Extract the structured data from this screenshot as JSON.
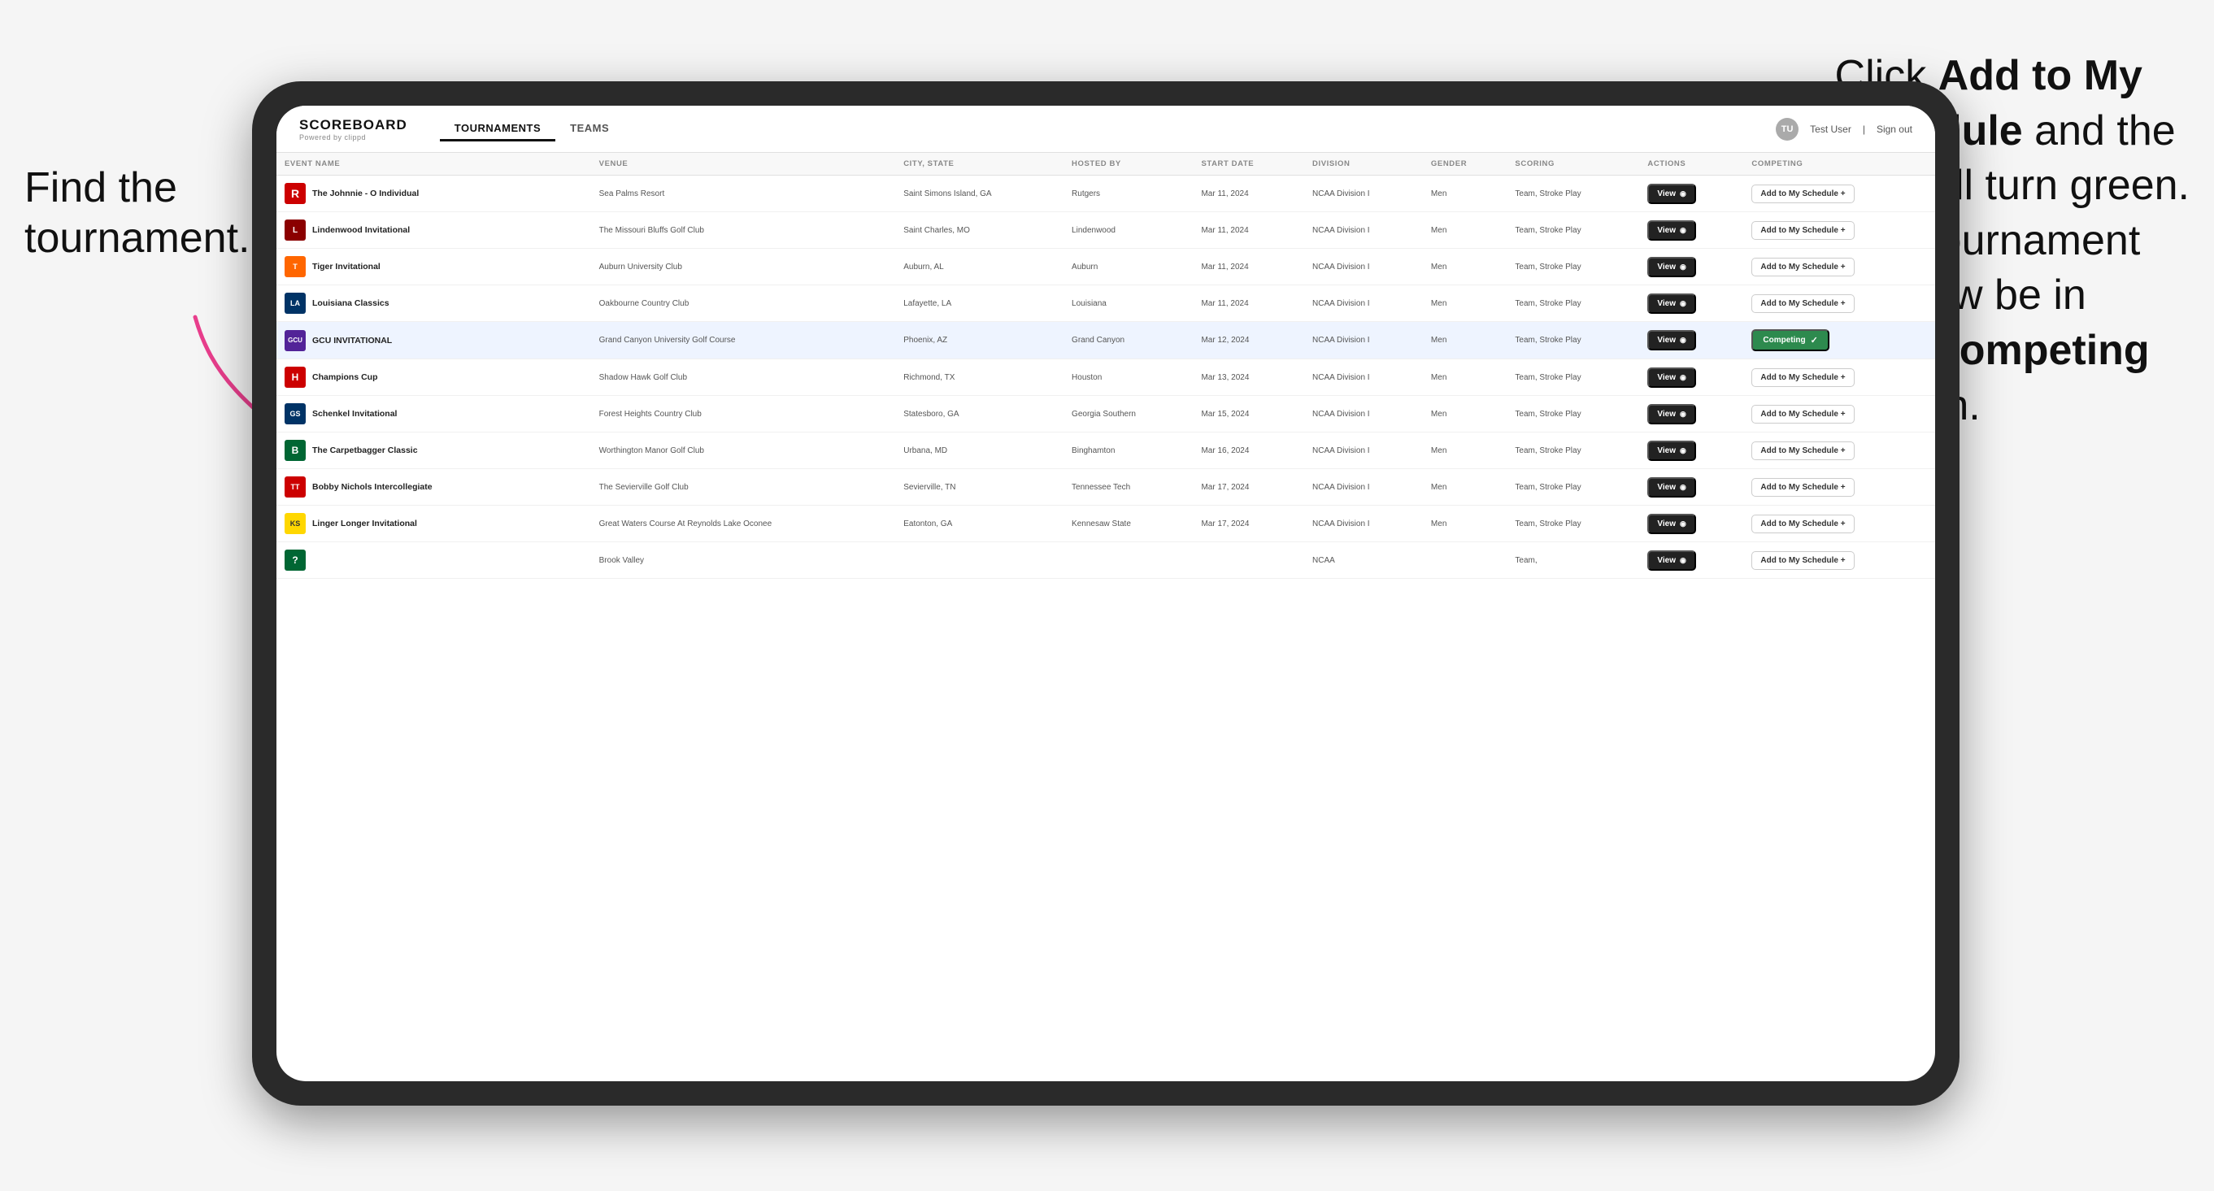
{
  "annotations": {
    "left": "Find the\ntournament.",
    "right_line1": "Click ",
    "right_bold1": "Add to My\nSchedule",
    "right_line2": " and the\nbox will turn green.\nThis tournament\nwill now be in\nyour ",
    "right_bold2": "Competing",
    "right_line3": "\nsection."
  },
  "header": {
    "logo_text": "SCOREBOARD",
    "logo_sub": "Powered by clippd",
    "nav_tabs": [
      "TOURNAMENTS",
      "TEAMS"
    ],
    "active_tab": "TOURNAMENTS",
    "user_label": "Test User",
    "signout_label": "Sign out"
  },
  "table": {
    "columns": [
      "EVENT NAME",
      "VENUE",
      "CITY, STATE",
      "HOSTED BY",
      "START DATE",
      "DIVISION",
      "GENDER",
      "SCORING",
      "ACTIONS",
      "COMPETING"
    ],
    "rows": [
      {
        "id": 1,
        "logo": "R",
        "logo_class": "logo-r",
        "name": "The Johnnie - O Individual",
        "venue": "Sea Palms Resort",
        "city_state": "Saint Simons Island, GA",
        "hosted_by": "Rutgers",
        "start_date": "Mar 11, 2024",
        "division": "NCAA Division I",
        "gender": "Men",
        "scoring": "Team, Stroke Play",
        "action": "View",
        "competing_state": "add",
        "competing_label": "Add to My Schedule +"
      },
      {
        "id": 2,
        "logo": "L",
        "logo_class": "logo-l",
        "name": "Lindenwood Invitational",
        "venue": "The Missouri Bluffs Golf Club",
        "city_state": "Saint Charles, MO",
        "hosted_by": "Lindenwood",
        "start_date": "Mar 11, 2024",
        "division": "NCAA Division I",
        "gender": "Men",
        "scoring": "Team, Stroke Play",
        "action": "View",
        "competing_state": "add",
        "competing_label": "Add to My Schedule +"
      },
      {
        "id": 3,
        "logo": "T",
        "logo_class": "logo-tiger",
        "name": "Tiger Invitational",
        "venue": "Auburn University Club",
        "city_state": "Auburn, AL",
        "hosted_by": "Auburn",
        "start_date": "Mar 11, 2024",
        "division": "NCAA Division I",
        "gender": "Men",
        "scoring": "Team, Stroke Play",
        "action": "View",
        "competing_state": "add",
        "competing_label": "Add to My Schedule +"
      },
      {
        "id": 4,
        "logo": "LA",
        "logo_class": "logo-la",
        "name": "Louisiana Classics",
        "venue": "Oakbourne Country Club",
        "city_state": "Lafayette, LA",
        "hosted_by": "Louisiana",
        "start_date": "Mar 11, 2024",
        "division": "NCAA Division I",
        "gender": "Men",
        "scoring": "Team, Stroke Play",
        "action": "View",
        "competing_state": "add",
        "competing_label": "Add to My Schedule +"
      },
      {
        "id": 5,
        "logo": "GCU",
        "logo_class": "logo-gcu",
        "name": "GCU INVITATIONAL",
        "venue": "Grand Canyon University Golf Course",
        "city_state": "Phoenix, AZ",
        "hosted_by": "Grand Canyon",
        "start_date": "Mar 12, 2024",
        "division": "NCAA Division I",
        "gender": "Men",
        "scoring": "Team, Stroke Play",
        "action": "View",
        "competing_state": "competing",
        "competing_label": "Competing ✓",
        "highlighted": true
      },
      {
        "id": 6,
        "logo": "H",
        "logo_class": "logo-h",
        "name": "Champions Cup",
        "venue": "Shadow Hawk Golf Club",
        "city_state": "Richmond, TX",
        "hosted_by": "Houston",
        "start_date": "Mar 13, 2024",
        "division": "NCAA Division I",
        "gender": "Men",
        "scoring": "Team, Stroke Play",
        "action": "View",
        "competing_state": "add",
        "competing_label": "Add to My Schedule +"
      },
      {
        "id": 7,
        "logo": "GS",
        "logo_class": "logo-gs",
        "name": "Schenkel Invitational",
        "venue": "Forest Heights Country Club",
        "city_state": "Statesboro, GA",
        "hosted_by": "Georgia Southern",
        "start_date": "Mar 15, 2024",
        "division": "NCAA Division I",
        "gender": "Men",
        "scoring": "Team, Stroke Play",
        "action": "View",
        "competing_state": "add",
        "competing_label": "Add to My Schedule +"
      },
      {
        "id": 8,
        "logo": "B",
        "logo_class": "logo-b",
        "name": "The Carpetbagger Classic",
        "venue": "Worthington Manor Golf Club",
        "city_state": "Urbana, MD",
        "hosted_by": "Binghamton",
        "start_date": "Mar 16, 2024",
        "division": "NCAA Division I",
        "gender": "Men",
        "scoring": "Team, Stroke Play",
        "action": "View",
        "competing_state": "add",
        "competing_label": "Add to My Schedule +"
      },
      {
        "id": 9,
        "logo": "TT",
        "logo_class": "logo-tt",
        "name": "Bobby Nichols Intercollegiate",
        "venue": "The Sevierville Golf Club",
        "city_state": "Sevierville, TN",
        "hosted_by": "Tennessee Tech",
        "start_date": "Mar 17, 2024",
        "division": "NCAA Division I",
        "gender": "Men",
        "scoring": "Team, Stroke Play",
        "action": "View",
        "competing_state": "add",
        "competing_label": "Add to My Schedule +"
      },
      {
        "id": 10,
        "logo": "KS",
        "logo_class": "logo-ks",
        "name": "Linger Longer Invitational",
        "venue": "Great Waters Course At Reynolds Lake Oconee",
        "city_state": "Eatonton, GA",
        "hosted_by": "Kennesaw State",
        "start_date": "Mar 17, 2024",
        "division": "NCAA Division I",
        "gender": "Men",
        "scoring": "Team, Stroke Play",
        "action": "View",
        "competing_state": "add",
        "competing_label": "Add to My Schedule +"
      },
      {
        "id": 11,
        "logo": "?",
        "logo_class": "logo-b",
        "name": "",
        "venue": "Brook Valley",
        "city_state": "",
        "hosted_by": "",
        "start_date": "",
        "division": "NCAA",
        "gender": "",
        "scoring": "Team,",
        "action": "View",
        "competing_state": "add",
        "competing_label": "Add to My Schedule +"
      }
    ]
  }
}
